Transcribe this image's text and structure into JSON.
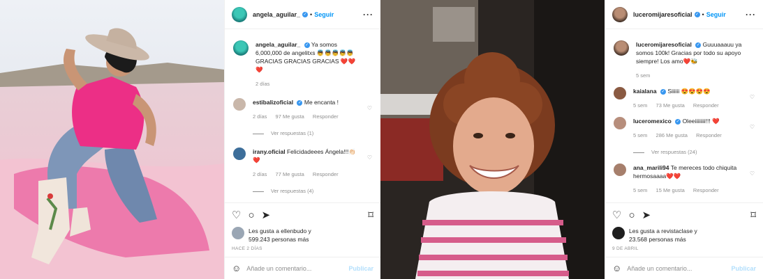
{
  "posts": [
    {
      "username": "angela_aguilar_",
      "follow_label": "Seguir",
      "caption_user": "angela_aguilar_",
      "caption_text": "Ya somos 6,000,000 de angelitxs 👼👼👼👼👼 GRACIAS GRACIAS GRACIAS ❤️❤️❤️",
      "caption_time": "2 días",
      "comments": [
        {
          "user": "estibalizoficial",
          "text": "Me encanta !",
          "time": "2 días",
          "likes": "97 Me gusta",
          "reply": "Responder",
          "view_replies": "Ver respuestas (1)"
        },
        {
          "user": "irany.oficial",
          "text": "Felicidadeees Ángela!!!👏🏻❤️",
          "time": "2 días",
          "likes": "77 Me gusta",
          "reply": "Responder",
          "view_replies": "Ver respuestas (4)"
        }
      ],
      "liked_by_line1": "Les gusta a ellenbudo y",
      "liked_by_line2": "599.243 personas más",
      "post_date": "HACE 2 DÍAS",
      "add_comment_placeholder": "Añade un comentario...",
      "publish_label": "Publicar"
    },
    {
      "username": "luceromijaresoficial",
      "follow_label": "Seguir",
      "caption_user": "luceromijaresoficial",
      "caption_text": "Guuuaaauu ya somos 100k! Gracias por todo su apoyo siempre! Los amo❤️🐝",
      "caption_time": "5 sem",
      "comments": [
        {
          "user": "kaialana",
          "text": "Siiiiii 😍😍😍😍",
          "time": "5 sem",
          "likes": "73 Me gusta",
          "reply": "Responder",
          "view_replies": ""
        },
        {
          "user": "luceromexico",
          "text": "Oleeiiiiiiii!!! ❤️",
          "time": "5 sem",
          "likes": "286 Me gusta",
          "reply": "Responder",
          "view_replies": "Ver respuestas (24)"
        },
        {
          "user": "ana_marili94",
          "text": "Te mereces todo chiquita hermosaaaa❤️❤️",
          "time": "5 sem",
          "likes": "15 Me gusta",
          "reply": "Responder",
          "view_replies": ""
        }
      ],
      "liked_by_line1": "Les gusta a revistaclase y",
      "liked_by_line2": "23.568 personas más",
      "post_date": "9 DE ABRIL",
      "add_comment_placeholder": "Añade un comentario...",
      "publish_label": "Publicar"
    }
  ],
  "icons": {
    "more": "more-options-icon",
    "like": "heart-icon",
    "comment": "comment-icon",
    "share": "share-icon",
    "save": "bookmark-icon",
    "emoji": "emoji-icon",
    "verified": "verified-badge-icon"
  },
  "colors": {
    "accent": "#0095f6",
    "verified": "#3897f0",
    "muted": "#8e8e8e",
    "publish_disabled": "#b2dffc"
  }
}
